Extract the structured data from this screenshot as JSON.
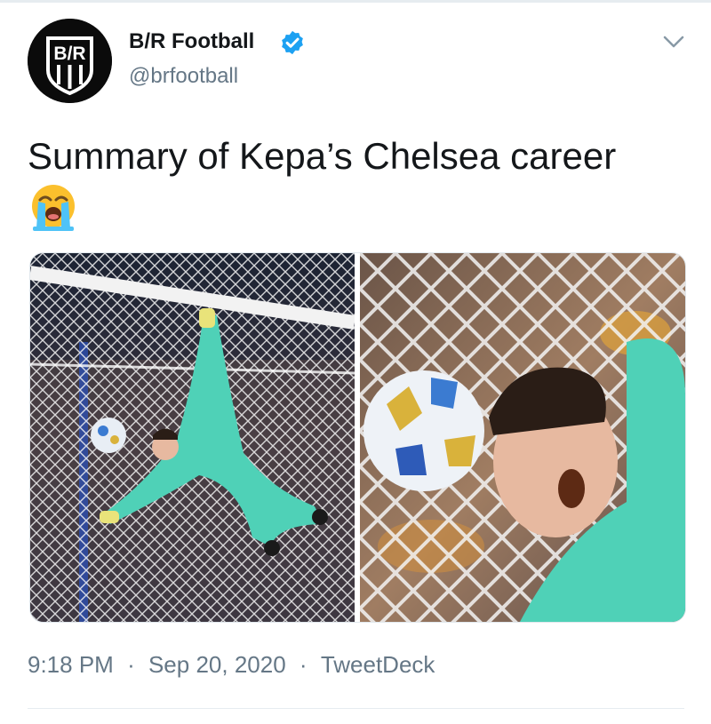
{
  "tweet": {
    "author": {
      "display_name": "B/R Football",
      "handle": "@brfootball",
      "avatar_text": "B/R",
      "verified": true,
      "verified_icon": "verified-badge-icon"
    },
    "text": "Summary of Kepa’s Chelsea career",
    "emoji": "loudly-crying-face",
    "media": [
      {
        "kind": "photo",
        "depicts": "goalkeeper-dive-wide"
      },
      {
        "kind": "photo",
        "depicts": "goalkeeper-closeup-ball"
      }
    ],
    "time": "9:18 PM",
    "date": "Sep 20, 2020",
    "source": "TweetDeck",
    "separator": "·"
  },
  "colors": {
    "verified_blue": "#1da1f2",
    "secondary_text": "#657786",
    "primary_text": "#14171a",
    "keeper_kit": "#4fd1b7"
  },
  "icons": {
    "menu": "chevron-down-icon"
  }
}
